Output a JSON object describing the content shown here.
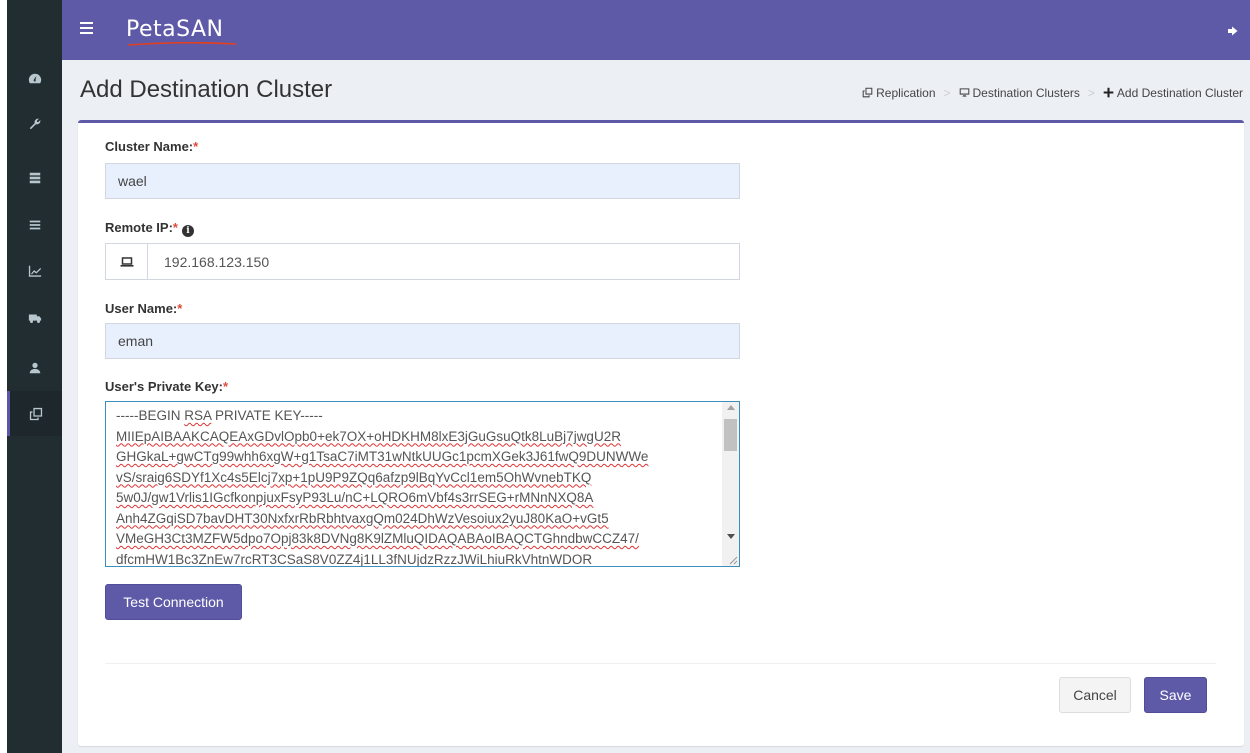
{
  "app": {
    "logo_text": "PetaSAN",
    "brand_color": "#5f5aa8",
    "logo_underline_color": "#e2401f"
  },
  "sidebar": {
    "items": [
      {
        "icon": "dashboard-icon"
      },
      {
        "icon": "wrench-icon"
      },
      {
        "icon": "server-icon"
      },
      {
        "icon": "list-icon"
      },
      {
        "icon": "chart-icon"
      },
      {
        "icon": "truck-icon"
      },
      {
        "icon": "user-icon"
      },
      {
        "icon": "clone-icon",
        "active": true
      }
    ]
  },
  "header": {
    "title": "Add Destination Cluster",
    "breadcrumb": [
      {
        "label": "Replication",
        "icon": "clone-icon"
      },
      {
        "label": "Destination Clusters",
        "icon": "desktop-icon"
      },
      {
        "label": "Add Destination Cluster",
        "icon": "plus-icon"
      }
    ]
  },
  "form": {
    "cluster_name": {
      "label": "Cluster Name:",
      "required_mark": "*",
      "value": "wael"
    },
    "remote_ip": {
      "label": "Remote IP:",
      "required_mark": "*",
      "info_glyph": "i",
      "value": "192.168.123.150"
    },
    "user_name": {
      "label": "User Name:",
      "required_mark": "*",
      "value": "eman"
    },
    "private_key": {
      "label": "User's Private Key:",
      "required_mark": "*",
      "line0_prefix": "-----BEGIN ",
      "line0_word": "RSA",
      "line0_suffix": " PRIVATE KEY-----",
      "lines": [
        "MIIEpAIBAAKCAQEAxGDvlOpb0+ek7OX+oHDKHM8lxE3jGuGsuQtk8LuBj7jwgU2R",
        "GHGkaL+gwCTg99whh6xgW+g1TsaC7iMT31wNtkUUGc1pcmXGek3J61fwQ9DUNWWe",
        "vS/sraig6SDYf1Xc4s5Elcj7xp+1pU9P9ZQq6afzp9lBqYvCcl1em5OhWvnebTKQ",
        "5w0J/gw1Vrlis1IGcfkonpjuxFsyP93Lu/nC+LQRO6mVbf4s3rrSEG+rMNnNXQ8A",
        "Anh4ZGqiSD7bavDHT30NxfxrRbRbhtvaxgQm024DhWzVesoiux2yuJ80KaO+vGt5",
        "VMeGH3Ct3MZFW5dpo7Opj83k8DVNg8K9lZMluQIDAQABAoIBAQCTGhndbwCCZ47/",
        "dfcmHW1Bc3ZnEw7rcRT3CSaS8V0ZZ4j1LL3fNUjdzRzzJWiLhiuRkVhtnWDOR"
      ]
    }
  },
  "buttons": {
    "test_connection": "Test Connection",
    "cancel": "Cancel",
    "save": "Save"
  }
}
